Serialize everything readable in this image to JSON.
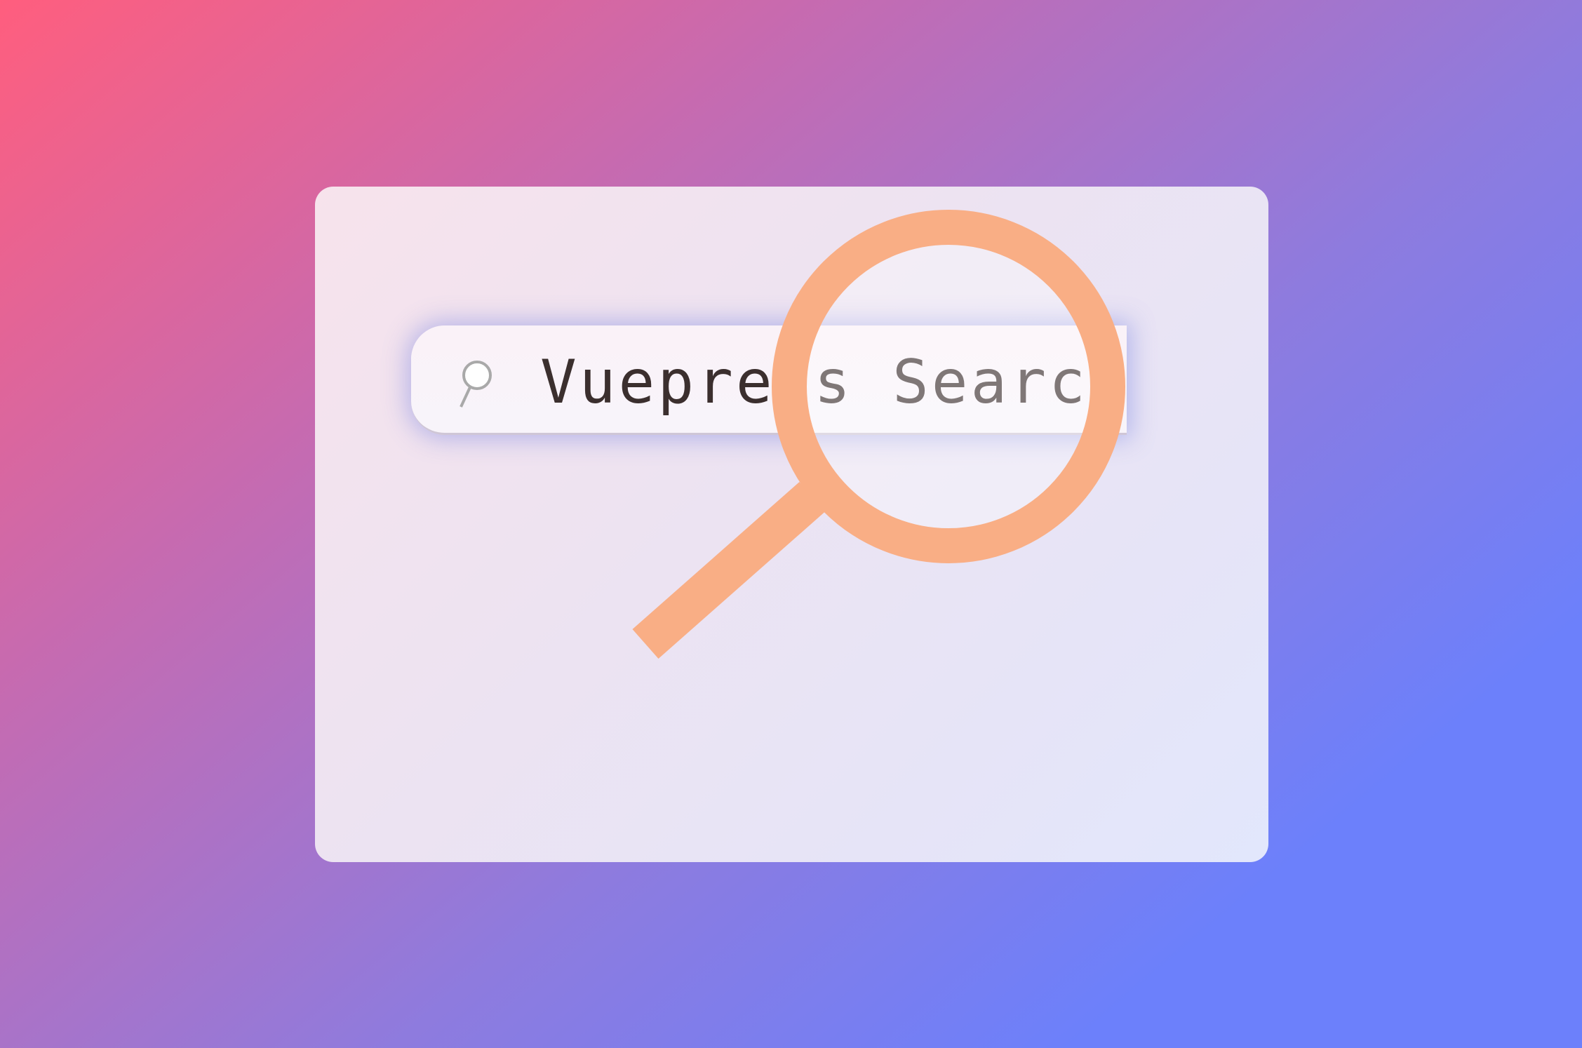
{
  "search": {
    "text": "Vuepress Search",
    "icon": "search-icon"
  },
  "illustration": {
    "icon": "magnifying-glass-icon",
    "color": "#f9ae85"
  },
  "colors": {
    "background_start": "#ff5e7e",
    "background_end": "#6c80fb",
    "card": "#ede3f1",
    "text": "#3b2f2e"
  }
}
